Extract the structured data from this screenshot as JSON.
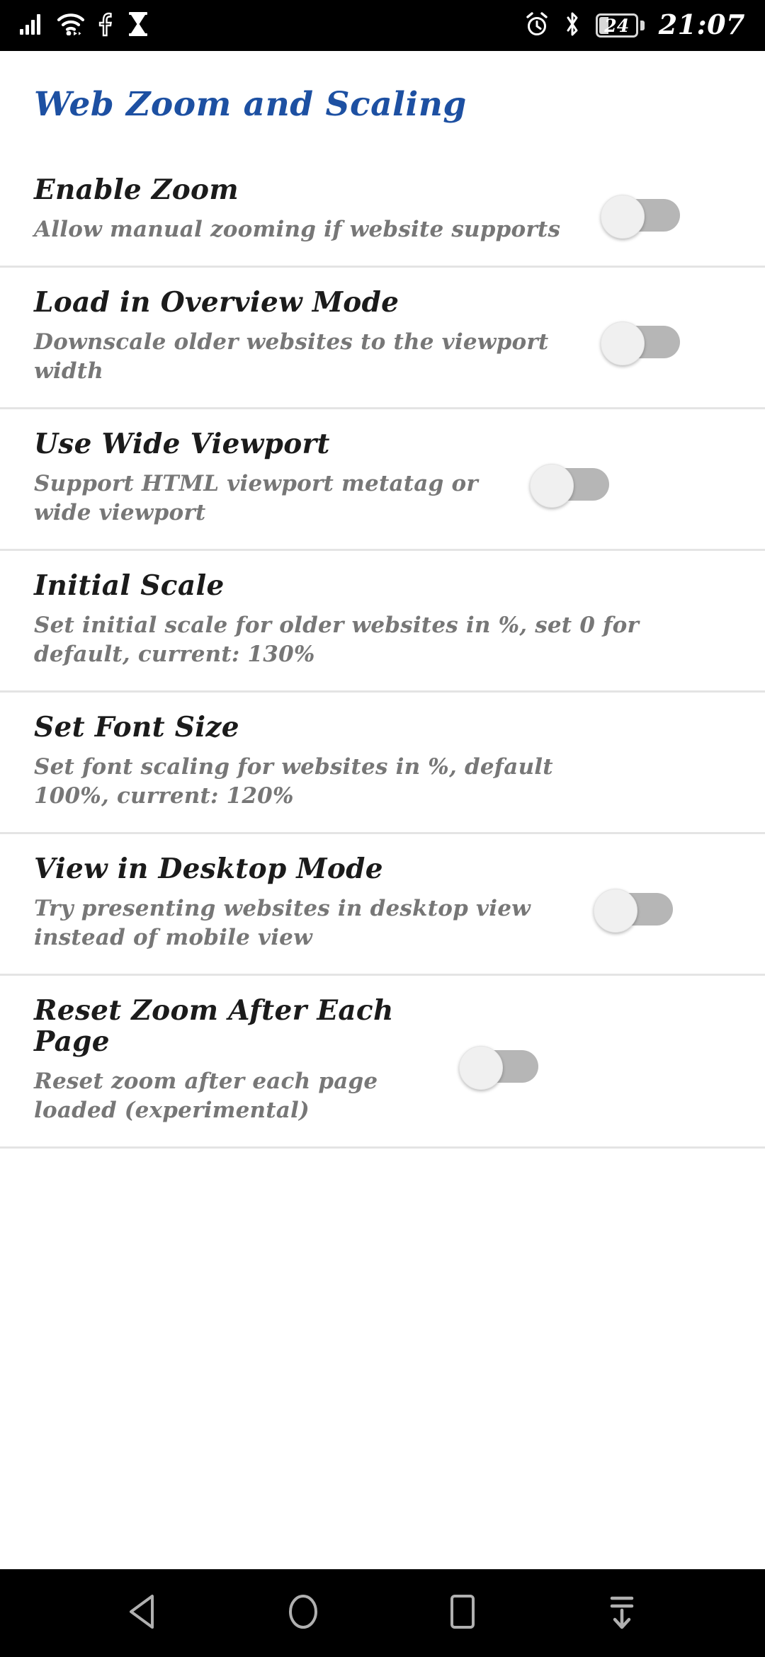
{
  "status_bar": {
    "left_icons": [
      {
        "name": "cellular-signal-icon",
        "label": "signal"
      },
      {
        "name": "wifi-icon",
        "label": "wifi"
      },
      {
        "name": "facebook-notification-icon",
        "label": "F"
      },
      {
        "name": "hourglass-icon",
        "label": "hourglass"
      }
    ],
    "alarm_icon": "alarm-clock-icon",
    "bluetooth_icon": "bluetooth-icon",
    "battery_percent": "24",
    "time": "21:07"
  },
  "page": {
    "title": "Web Zoom and Scaling",
    "title_color": "#1d50a2"
  },
  "settings": [
    {
      "name": "enable-zoom",
      "title": "Enable Zoom",
      "subtitle": "Allow manual zooming if website supports",
      "has_toggle": true,
      "toggle_state": "off"
    },
    {
      "name": "load-in-overview-mode",
      "title": "Load in Overview Mode",
      "subtitle": "Downscale older websites to the viewport width",
      "has_toggle": true,
      "toggle_state": "off"
    },
    {
      "name": "use-wide-viewport",
      "title": "Use Wide Viewport",
      "subtitle": "Support HTML viewport metatag or wide viewport",
      "has_toggle": true,
      "toggle_state": "off"
    },
    {
      "name": "initial-scale",
      "title": "Initial Scale",
      "subtitle": "Set initial scale for older websites in %, set 0 for default, current: 130%",
      "has_toggle": false,
      "toggle_state": null
    },
    {
      "name": "set-font-size",
      "title": "Set Font Size",
      "subtitle": "Set font scaling for websites in %, default 100%, current: 120%",
      "has_toggle": false,
      "toggle_state": null
    },
    {
      "name": "view-in-desktop-mode",
      "title": "View in Desktop Mode",
      "subtitle": "Try presenting websites in desktop view instead of mobile view",
      "has_toggle": true,
      "toggle_state": "off"
    },
    {
      "name": "reset-zoom-after-each-page",
      "title": "Reset Zoom After Each Page",
      "subtitle": "Reset zoom after each page loaded (experimental)",
      "has_toggle": true,
      "toggle_state": "off"
    }
  ],
  "nav_bar": {
    "buttons": [
      {
        "name": "nav-back-button",
        "icon": "back-triangle-icon"
      },
      {
        "name": "nav-home-button",
        "icon": "home-circle-icon"
      },
      {
        "name": "nav-recents-button",
        "icon": "recents-square-icon"
      },
      {
        "name": "nav-hide-keyboard-button",
        "icon": "hide-down-arrow-icon"
      }
    ]
  },
  "colors": {
    "accent_blue": "#1d50a2",
    "title_text": "#1b1b1b",
    "subtitle_text": "#777777",
    "divider": "#e4e4e4",
    "toggle_track_off": "#b6b6b6",
    "toggle_thumb_off": "#f0f0f0",
    "status_bar_bg": "#000000"
  }
}
